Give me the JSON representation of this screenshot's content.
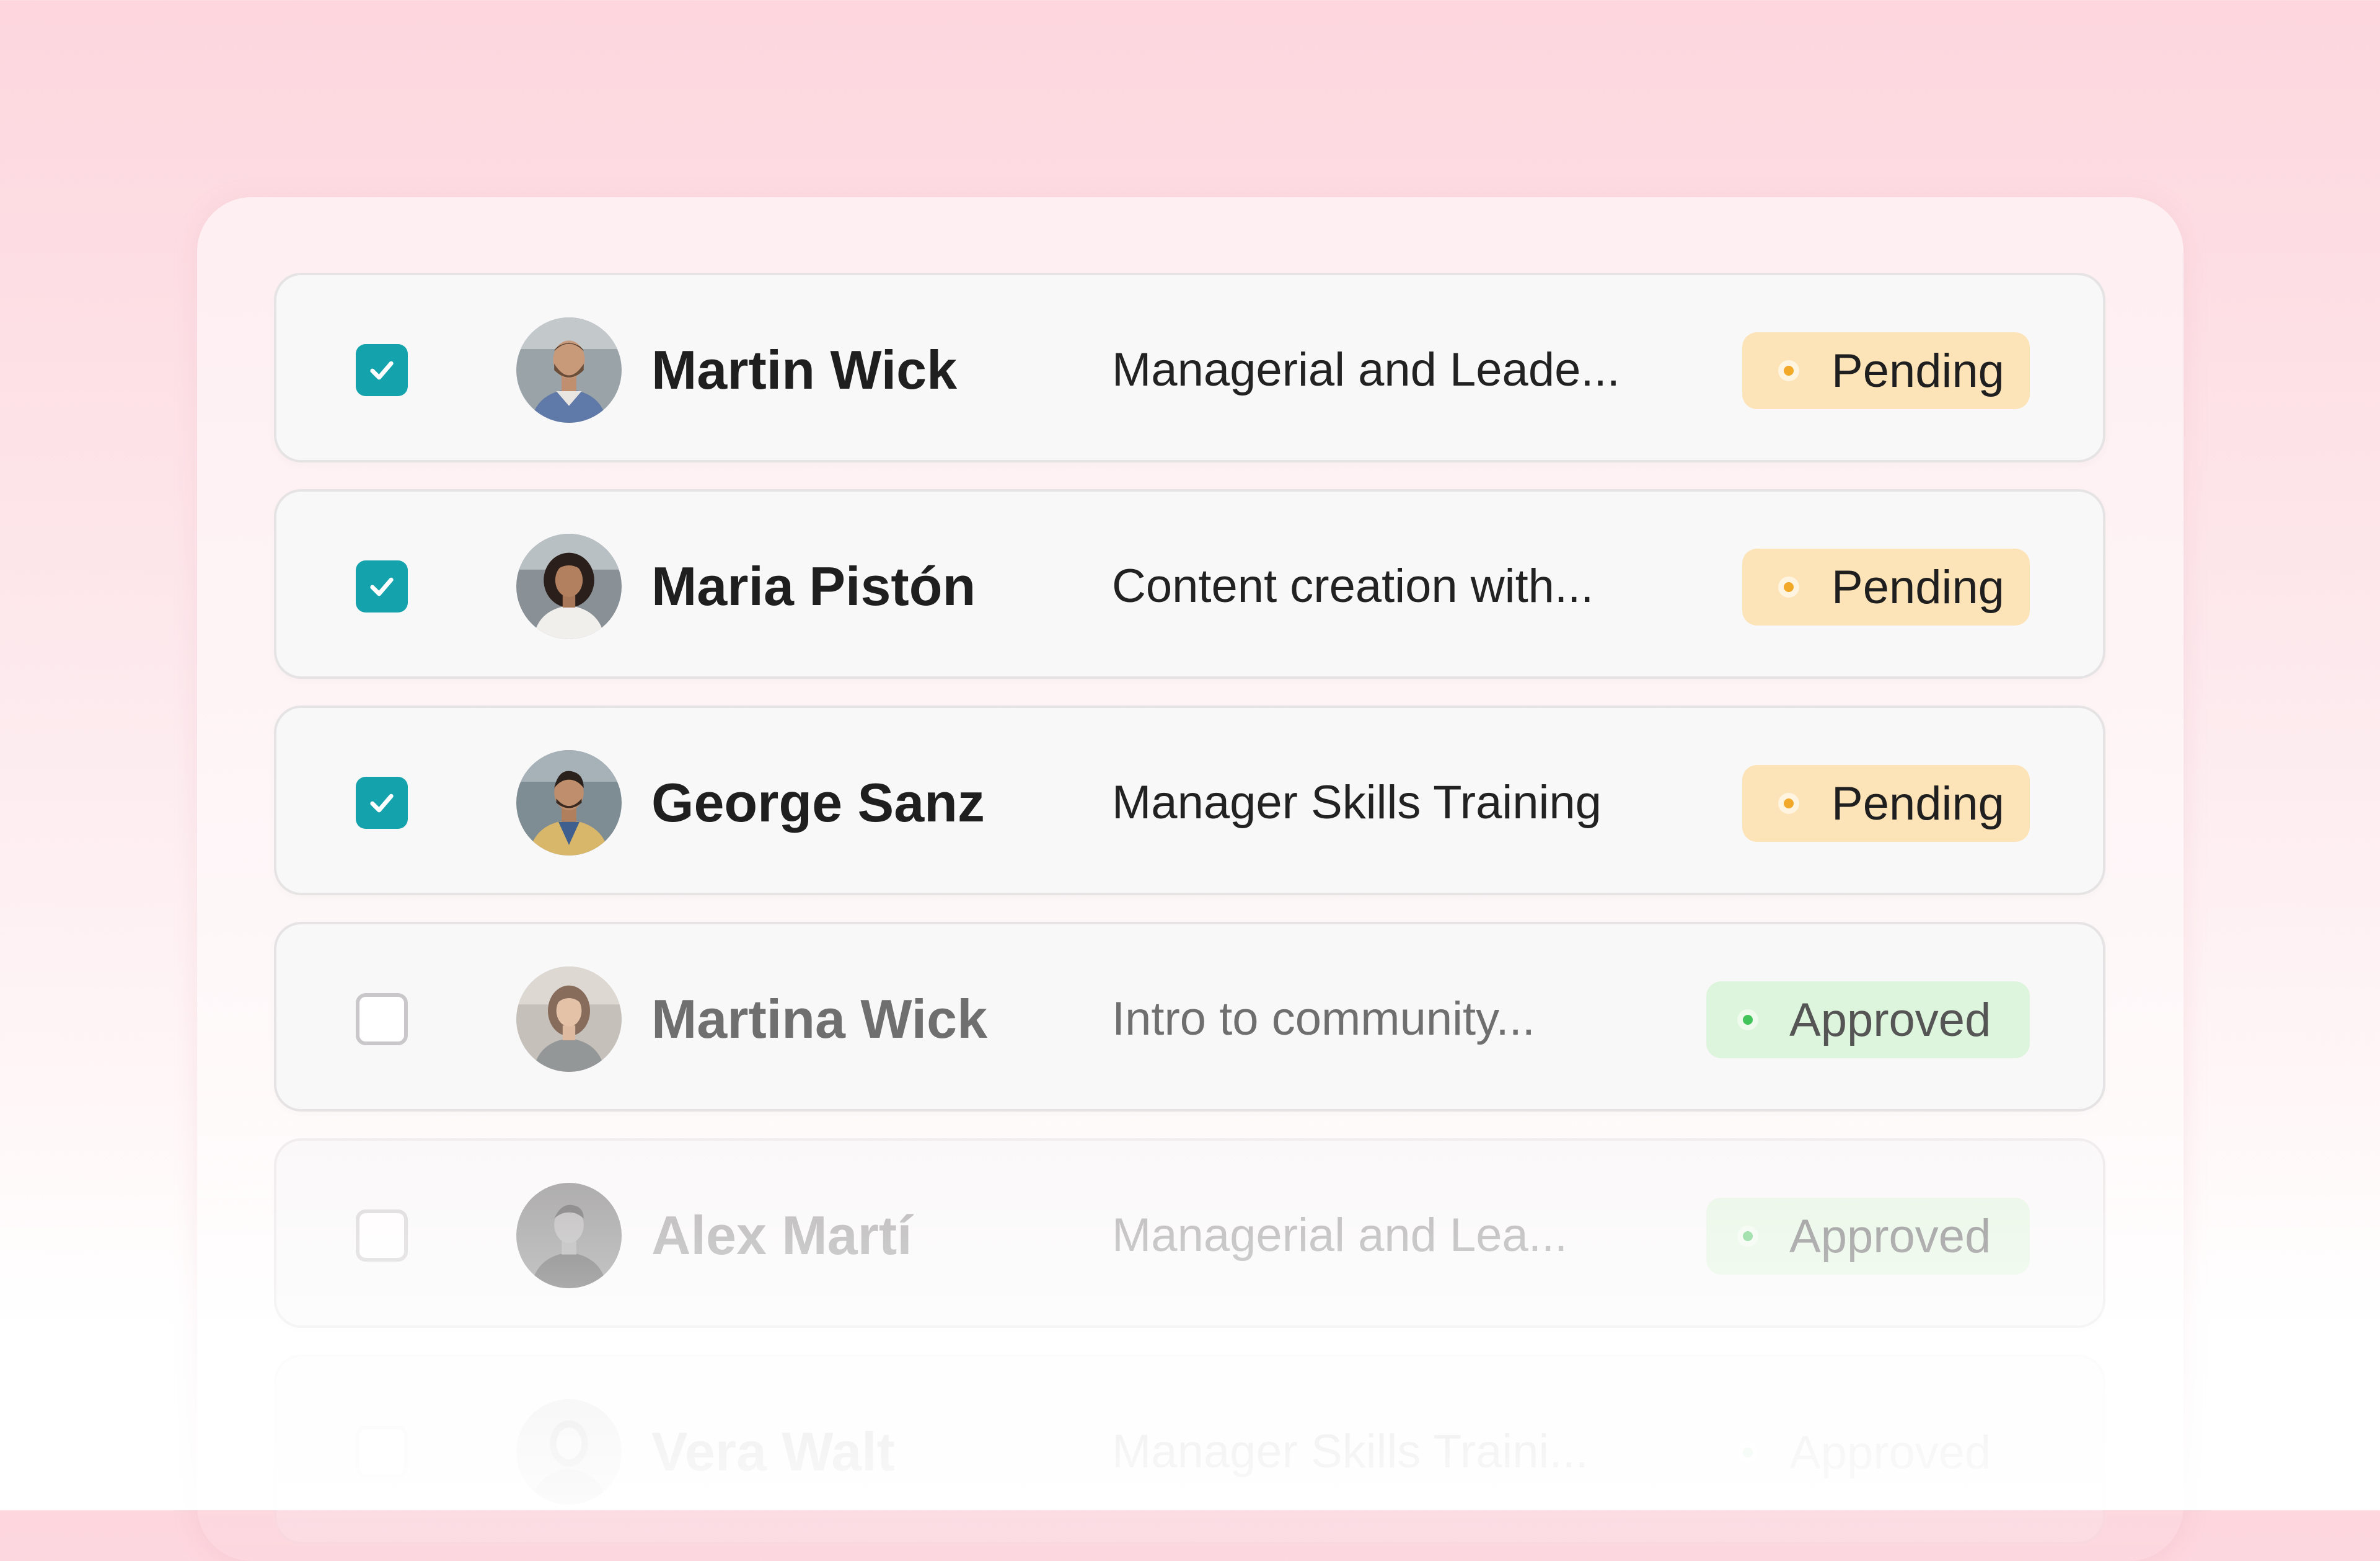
{
  "colors": {
    "checkbox_checked": "#14a3ac",
    "pending_badge_bg": "#fce4b8",
    "pending_dot": "#f2a828",
    "approved_badge_bg": "#ddf5dc",
    "approved_dot": "#42c45a"
  },
  "rows": [
    {
      "checked": true,
      "avatar_icon": "person-avatar-man-beard-icon",
      "name": "Martin Wick",
      "course": "Managerial and Leade...",
      "status": "Pending",
      "status_type": "pending"
    },
    {
      "checked": true,
      "avatar_icon": "person-avatar-woman-curly-icon",
      "name": "Maria Pistón",
      "course": "Content creation with...",
      "status": "Pending",
      "status_type": "pending"
    },
    {
      "checked": true,
      "avatar_icon": "person-avatar-man-jacket-icon",
      "name": "George Sanz",
      "course": "Manager Skills Training",
      "status": "Pending",
      "status_type": "pending"
    },
    {
      "checked": false,
      "avatar_icon": "person-avatar-woman-icon",
      "name": "Martina Wick",
      "course": "Intro to community...",
      "status": "Approved",
      "status_type": "approved"
    },
    {
      "checked": false,
      "avatar_icon": "person-avatar-man-dark-icon",
      "name": "Alex Martí",
      "course": "Managerial and Lea...",
      "status": "Approved",
      "status_type": "approved"
    },
    {
      "checked": false,
      "avatar_icon": "person-avatar-faded-icon",
      "name": "Vera Walt",
      "course": "Manager Skills Traini...",
      "status": "Approved",
      "status_type": "approved"
    }
  ]
}
